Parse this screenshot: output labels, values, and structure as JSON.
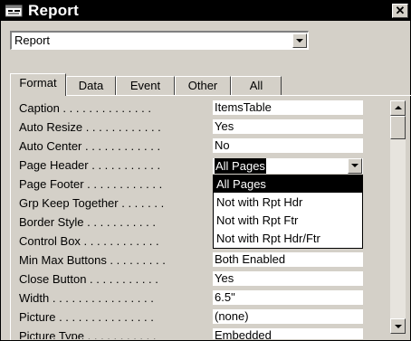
{
  "window": {
    "title": "Report",
    "close_glyph": "✕"
  },
  "object_selector": {
    "value": "Report"
  },
  "tabs": [
    {
      "label": "Format",
      "active": true
    },
    {
      "label": "Data"
    },
    {
      "label": "Event"
    },
    {
      "label": "Other"
    },
    {
      "label": "All"
    }
  ],
  "properties": [
    {
      "label": "Caption . . . . . . . . . . . . . .",
      "value": "ItemsTable"
    },
    {
      "label": "Auto Resize . . . . . . . . . . . .",
      "value": "Yes"
    },
    {
      "label": "Auto Center . . . . . . . . . . . .",
      "value": "No"
    },
    {
      "label": "Page Header . . . . . . . . . . .",
      "value": "All Pages"
    },
    {
      "label": "Page Footer . . . . . . . . . . . .",
      "value": ""
    },
    {
      "label": "Grp Keep Together . . . . . . .",
      "value": ""
    },
    {
      "label": "Border Style . . . . . . . . . . .",
      "value": ""
    },
    {
      "label": "Control Box . . . . . . . . . . . .",
      "value": ""
    },
    {
      "label": "Min Max Buttons . . . . . . . . .",
      "value": "Both Enabled"
    },
    {
      "label": "Close Button . . . . . . . . . . .",
      "value": "Yes"
    },
    {
      "label": "Width . . . . . . . . . . . . . . . .",
      "value": "6.5\""
    },
    {
      "label": "Picture . . . . . . . . . . . . . . .",
      "value": "(none)"
    },
    {
      "label": "Picture Type . . . . . . . . . . .",
      "value": "Embedded"
    }
  ],
  "dropdown": {
    "current": "All Pages",
    "options": [
      "All Pages",
      "Not with Rpt Hdr",
      "Not with Rpt Ftr",
      "Not with Rpt Hdr/Ftr"
    ],
    "selected_index": 0
  },
  "colors": {
    "title_bar": "#000000",
    "face": "#d4d0c8",
    "field": "#ffffff",
    "highlight": "#000000"
  }
}
